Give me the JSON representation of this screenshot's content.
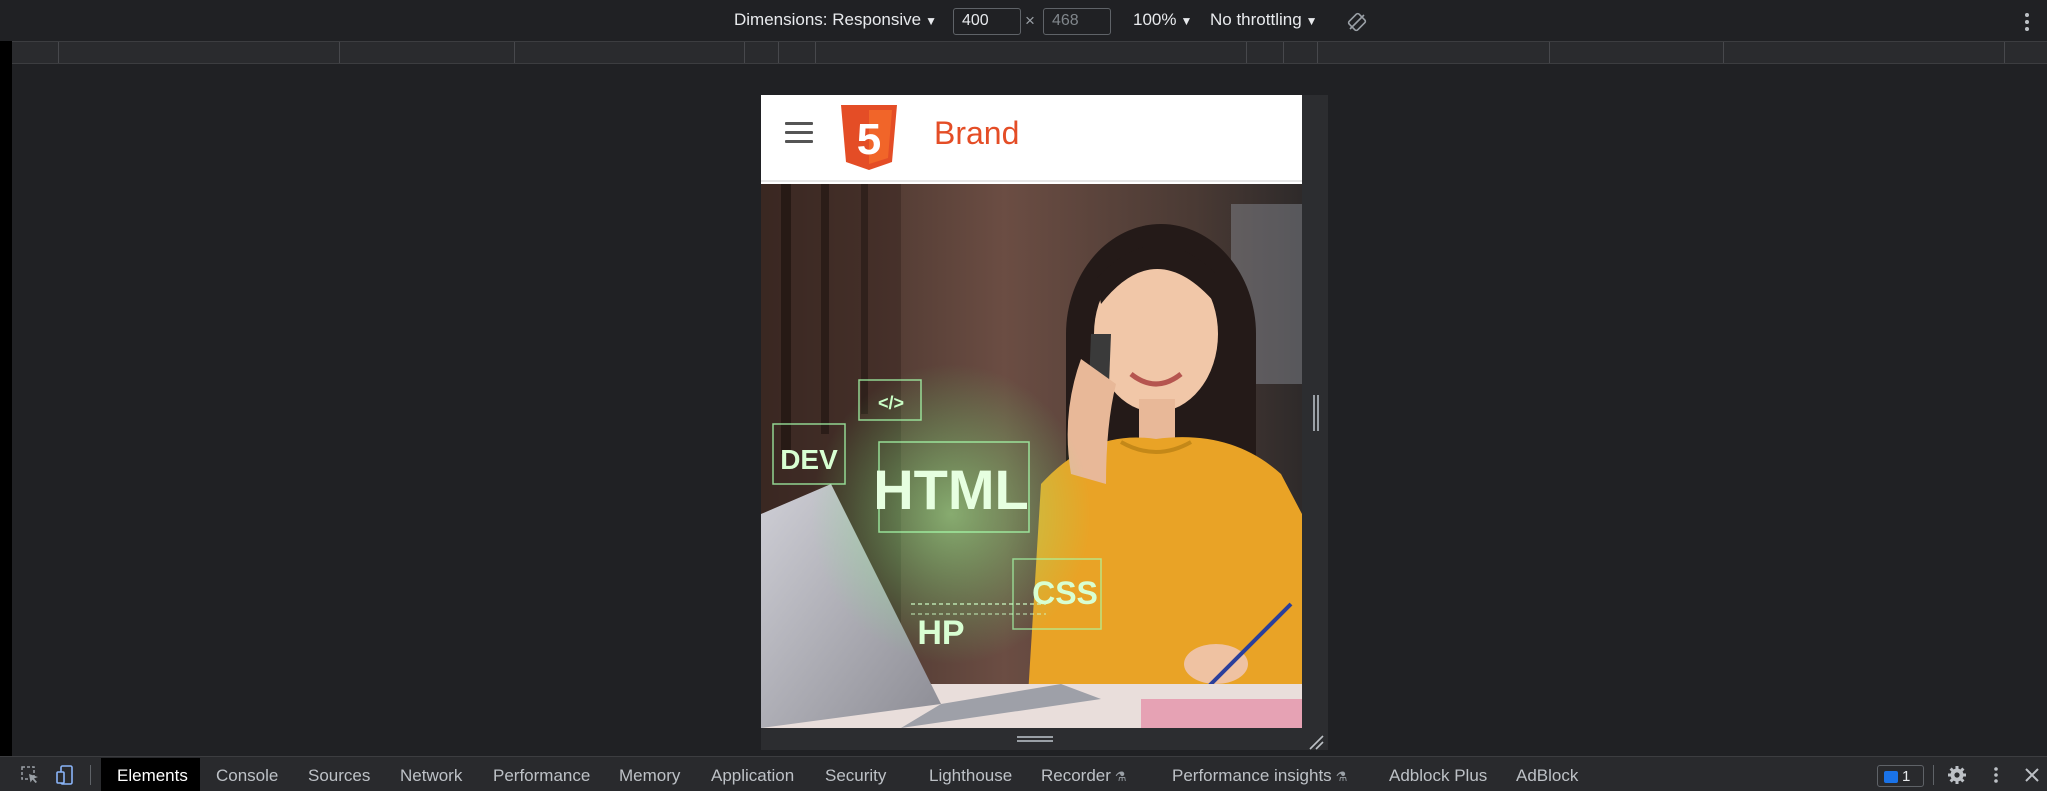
{
  "device_toolbar": {
    "dimensions_label": "Dimensions: Responsive",
    "width_value": "400",
    "times_symbol": "×",
    "height_placeholder": "468",
    "zoom_label": "100%",
    "throttling_label": "No throttling"
  },
  "page": {
    "brand": "Brand",
    "logo_digit": "5",
    "hero": {
      "tag_dev": "DEV",
      "tag_code": "</>",
      "tag_html": "HTML",
      "tag_css": "CSS",
      "tag_php": "HP"
    }
  },
  "devtools": {
    "tabs": [
      {
        "label": "Elements"
      },
      {
        "label": "Console"
      },
      {
        "label": "Sources"
      },
      {
        "label": "Network"
      },
      {
        "label": "Performance"
      },
      {
        "label": "Memory"
      },
      {
        "label": "Application"
      },
      {
        "label": "Security"
      },
      {
        "label": "Lighthouse"
      },
      {
        "label": "Recorder"
      },
      {
        "label": "Performance insights"
      },
      {
        "label": "Adblock Plus"
      },
      {
        "label": "AdBlock"
      }
    ],
    "issues_count": "1"
  },
  "colors": {
    "brand": "#e44d26",
    "devtools_bg": "#202124",
    "tabbar_bg": "#292a2d"
  }
}
